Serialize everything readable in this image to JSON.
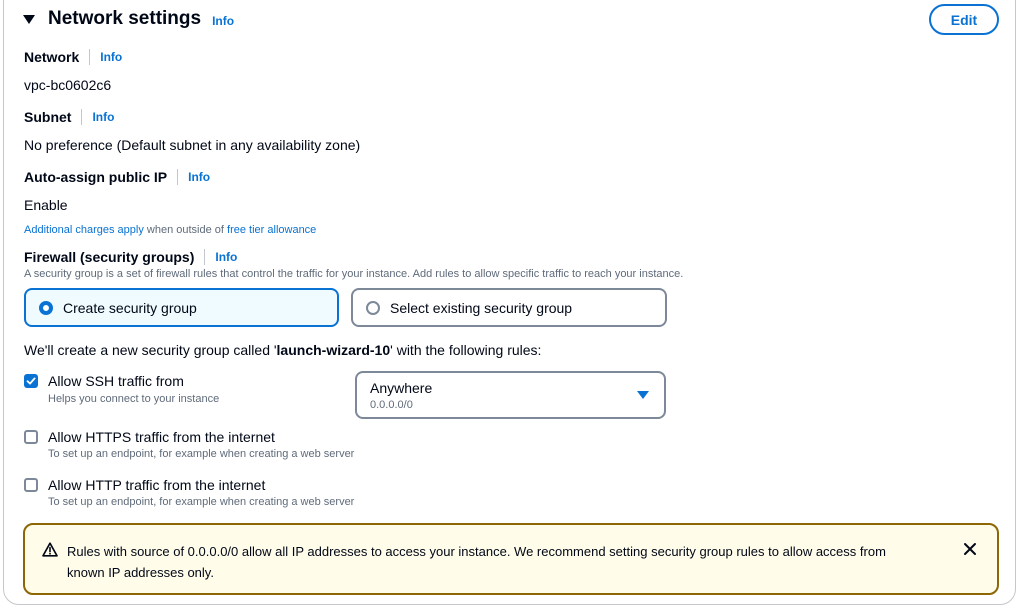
{
  "section": {
    "title": "Network settings",
    "info": "Info",
    "edit_label": "Edit"
  },
  "network": {
    "label": "Network",
    "info": "Info",
    "value": "vpc-bc0602c6"
  },
  "subnet": {
    "label": "Subnet",
    "info": "Info",
    "value": "No preference (Default subnet in any availability zone)"
  },
  "public_ip": {
    "label": "Auto-assign public IP",
    "info": "Info",
    "value": "Enable",
    "note_link1": "Additional charges apply",
    "note_mid": " when outside of ",
    "note_link2": "free tier allowance"
  },
  "firewall": {
    "label": "Firewall (security groups)",
    "info": "Info",
    "description": "A security group is a set of firewall rules that control the traffic for your instance. Add rules to allow specific traffic to reach your instance.",
    "option_create": "Create security group",
    "option_existing": "Select existing security group",
    "selected": "Create security group",
    "intro_prefix": "We'll create a new security group called '",
    "group_name": "launch-wizard-10",
    "intro_suffix": "' with the following rules:"
  },
  "rules": [
    {
      "label": "Allow SSH traffic from",
      "description": "Helps you connect to your instance",
      "checked": true
    },
    {
      "label": "Allow HTTPS traffic from the internet",
      "description": "To set up an endpoint, for example when creating a web server",
      "checked": false
    },
    {
      "label": "Allow HTTP traffic from the internet",
      "description": "To set up an endpoint, for example when creating a web server",
      "checked": false
    }
  ],
  "ssh_source": {
    "value": "Anywhere",
    "detail": "0.0.0.0/0"
  },
  "alert": {
    "type": "warning",
    "text": "Rules with source of 0.0.0.0/0 allow all IP addresses to access your instance. We recommend setting security group rules to allow access from known IP addresses only."
  },
  "colors": {
    "accent": "#0972d3",
    "warning_border": "#8d6605",
    "warning_bg": "#fffce9",
    "text": "#000716",
    "muted": "#5f6b7a"
  },
  "icons": {
    "section_toggle": "caret-down-icon",
    "checkbox_checked": "checkmark-icon",
    "select_arrow": "caret-down-icon",
    "alert": "warning-triangle-icon",
    "alert_dismiss": "close-icon"
  }
}
